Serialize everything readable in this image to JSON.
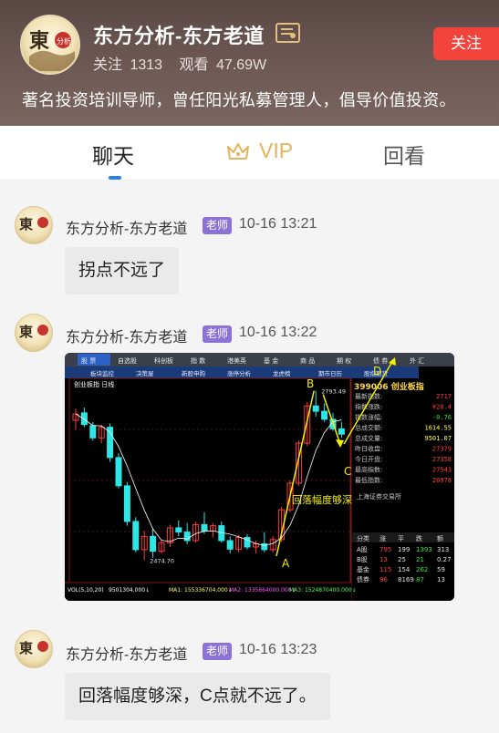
{
  "channel": {
    "name": "东方分析-东方老道",
    "follow_label": "关注",
    "followers": "1313",
    "views_label": "观看",
    "views": "47.69W",
    "follow_button": "关注",
    "description": "著名投资培训导师，曾任阳光私募管理人，倡导价值投资。"
  },
  "tabs": [
    {
      "label": "聊天",
      "active": true
    },
    {
      "label": "VIP",
      "active": false
    },
    {
      "label": "回看",
      "active": false
    }
  ],
  "messages": [
    {
      "sender": "东方分析-东方老道",
      "badge": "老师",
      "time": "10-16 13:21",
      "text": "拐点不远了"
    },
    {
      "sender": "东方分析-东方老道",
      "badge": "老师",
      "time": "10-16 13:22",
      "image": {
        "menu": [
          "股 票",
          "自选股",
          "科创板",
          "指 数",
          "港美英",
          "基 金",
          "商 品",
          "期 权",
          "债 券",
          "外 汇"
        ],
        "submenu": [
          "板块监控",
          "决策屋",
          "新股申购",
          "涨停分析",
          "龙虎榜",
          "期市日历",
          "股指期货"
        ],
        "index_title": "399006 创业板指",
        "chart_label": "创业板指 日线",
        "high_label": "2793.49",
        "low_label": "2474.70",
        "annotation": "回落幅度够深",
        "points": [
          "A",
          "B",
          "C",
          "D"
        ],
        "quote_rows": [
          {
            "label": "最新指数:",
            "value": "2717"
          },
          {
            "label": "指数涨跌:",
            "value": "¥20.4"
          },
          {
            "label": "指数涨幅:",
            "value": "-0.76"
          },
          {
            "label": "总成交额:",
            "value": "1614.55"
          },
          {
            "label": "总成交量:",
            "value": "9501.07"
          },
          {
            "label": "昨日收盘:",
            "value": "27379"
          },
          {
            "label": "今日开盘:",
            "value": "27358"
          },
          {
            "label": "最高指数:",
            "value": "27543"
          },
          {
            "label": "最低指数:",
            "value": "26978"
          }
        ],
        "market_header": "上海证券交易所",
        "market_rows": [
          [
            "A股",
            "795",
            "199",
            "1393",
            "313"
          ],
          [
            "B股",
            "13",
            "25",
            "21",
            "0.27"
          ],
          [
            "基金",
            "115",
            "154",
            "262",
            "59"
          ],
          [
            "债券",
            "96",
            "8169",
            "87",
            "13"
          ]
        ],
        "market_cols": [
          "分类",
          "涨",
          "平",
          "跌",
          "额"
        ],
        "bottom_vol": "VOL(5,10,20)",
        "bottom_vals": [
          "9501304.000↓",
          "MA1: 155336704.000↓",
          "MA2: 1335864000.000↓",
          "MA3: 1524870400.000↓"
        ]
      }
    },
    {
      "sender": "东方分析-东方老道",
      "badge": "老师",
      "time": "10-16 13:23",
      "text": "回落幅度够深，C点就不远了。"
    }
  ],
  "colors": {
    "follow_button": "#f2433d",
    "tab_indicator": "#2f7ee6",
    "vip": "#e6b35a",
    "badge": "#8b73d6",
    "chart_up": "#ff3b3b",
    "chart_down": "#2ee6e6",
    "annotation": "#f3f000"
  },
  "chart_data": {
    "type": "candlestick",
    "title": "创业板指 日线",
    "annotation_points": [
      "A",
      "B",
      "C",
      "D"
    ],
    "labels": [
      "2793.49",
      "2474.70"
    ],
    "candles": [
      {
        "o": 2738,
        "h": 2760,
        "l": 2720,
        "c": 2750
      },
      {
        "o": 2752,
        "h": 2762,
        "l": 2725,
        "c": 2730
      },
      {
        "o": 2728,
        "h": 2735,
        "l": 2700,
        "c": 2705
      },
      {
        "o": 2705,
        "h": 2730,
        "l": 2695,
        "c": 2725
      },
      {
        "o": 2725,
        "h": 2732,
        "l": 2660,
        "c": 2668
      },
      {
        "o": 2668,
        "h": 2676,
        "l": 2610,
        "c": 2615
      },
      {
        "o": 2615,
        "h": 2622,
        "l": 2540,
        "c": 2548
      },
      {
        "o": 2548,
        "h": 2556,
        "l": 2490,
        "c": 2495
      },
      {
        "o": 2495,
        "h": 2530,
        "l": 2474.7,
        "c": 2520
      },
      {
        "o": 2520,
        "h": 2535,
        "l": 2480,
        "c": 2492
      },
      {
        "o": 2492,
        "h": 2512,
        "l": 2488,
        "c": 2508
      },
      {
        "o": 2508,
        "h": 2542,
        "l": 2500,
        "c": 2536
      },
      {
        "o": 2536,
        "h": 2550,
        "l": 2520,
        "c": 2528
      },
      {
        "o": 2528,
        "h": 2545,
        "l": 2505,
        "c": 2512
      },
      {
        "o": 2512,
        "h": 2548,
        "l": 2508,
        "c": 2542
      },
      {
        "o": 2542,
        "h": 2565,
        "l": 2525,
        "c": 2530
      },
      {
        "o": 2530,
        "h": 2545,
        "l": 2518,
        "c": 2540
      },
      {
        "o": 2540,
        "h": 2548,
        "l": 2508,
        "c": 2512
      },
      {
        "o": 2512,
        "h": 2520,
        "l": 2488,
        "c": 2496
      },
      {
        "o": 2496,
        "h": 2522,
        "l": 2490,
        "c": 2518
      },
      {
        "o": 2518,
        "h": 2524,
        "l": 2495,
        "c": 2500
      },
      {
        "o": 2500,
        "h": 2512,
        "l": 2488,
        "c": 2506
      },
      {
        "o": 2506,
        "h": 2528,
        "l": 2490,
        "c": 2495
      },
      {
        "o": 2495,
        "h": 2520,
        "l": 2490,
        "c": 2514
      },
      {
        "o": 2514,
        "h": 2575,
        "l": 2510,
        "c": 2570
      },
      {
        "o": 2570,
        "h": 2625,
        "l": 2565,
        "c": 2620
      },
      {
        "o": 2620,
        "h": 2700,
        "l": 2615,
        "c": 2695
      },
      {
        "o": 2695,
        "h": 2772,
        "l": 2690,
        "c": 2765
      },
      {
        "o": 2765,
        "h": 2793.49,
        "l": 2745,
        "c": 2755
      },
      {
        "o": 2755,
        "h": 2770,
        "l": 2735,
        "c": 2740
      },
      {
        "o": 2740,
        "h": 2752,
        "l": 2718,
        "c": 2722
      },
      {
        "o": 2722,
        "h": 2735,
        "l": 2705,
        "c": 2712
      }
    ],
    "ylim": [
      2440,
      2810
    ]
  }
}
